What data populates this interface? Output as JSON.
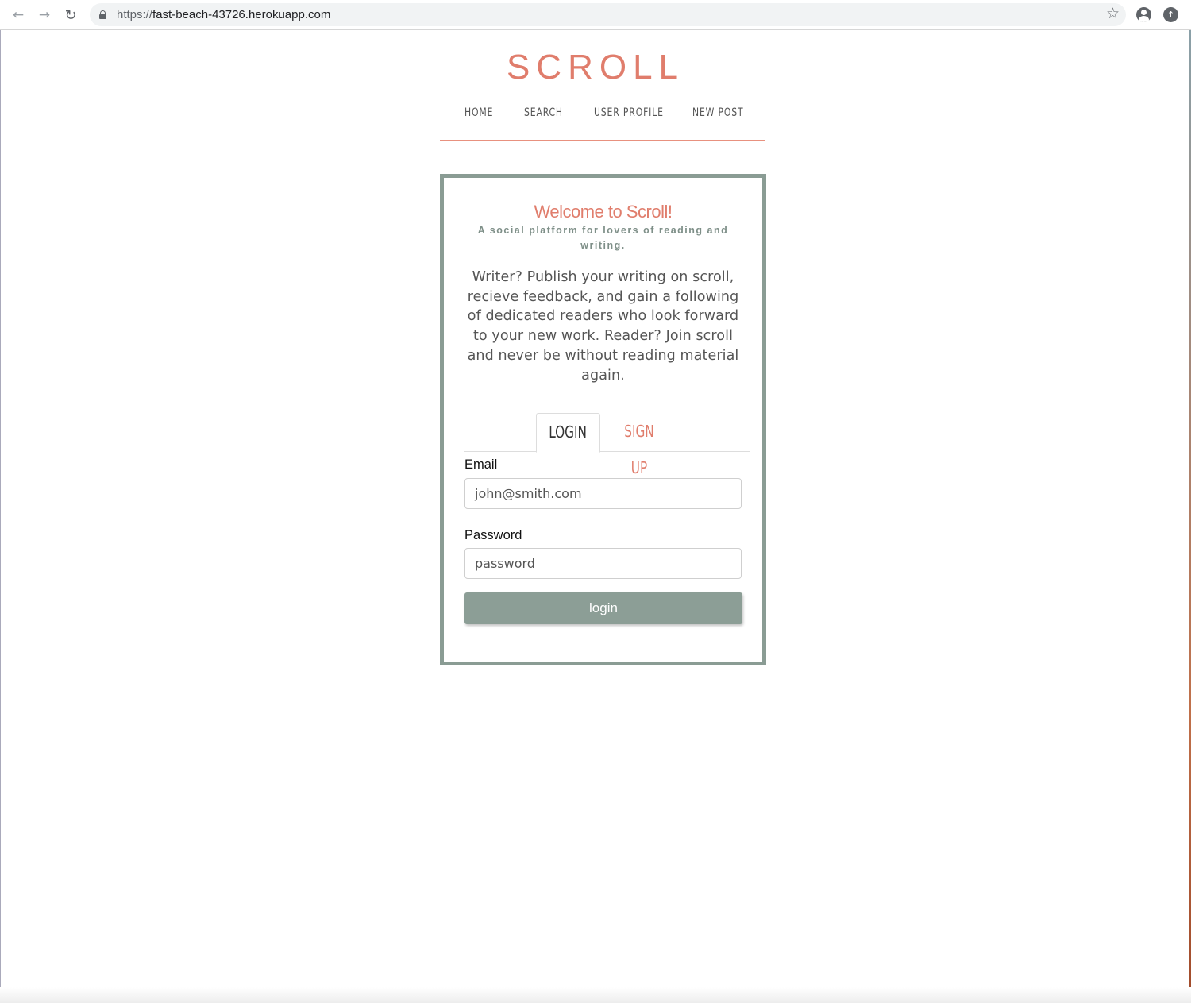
{
  "browser": {
    "url_scheme": "https://",
    "url_host": "fast-beach-43726.herokuapp.com",
    "back_icon": "←",
    "forward_icon": "→",
    "reload_icon": "↻",
    "bookmark_icon": "☆",
    "update_icon": "↑"
  },
  "site": {
    "brand": "SCROLL",
    "accent_color": "#e07d6c",
    "frame_color": "#8a9c94",
    "nav": [
      {
        "label": "HOME"
      },
      {
        "label": "SEARCH"
      },
      {
        "label": "USER PROFILE"
      },
      {
        "label": "NEW POST"
      }
    ]
  },
  "card": {
    "title": "Welcome to Scroll!",
    "tagline": "A social platform for lovers of reading and writing.",
    "intro": "Writer? Publish your writing on scroll, recieve feedback, and gain a following of dedicated readers who look forward to your new work. Reader? Join scroll and never be without reading material again.",
    "tabs": [
      {
        "label": "LOGIN",
        "active": true
      },
      {
        "label": "SIGN UP",
        "active": false
      }
    ],
    "email_label": "Email",
    "email_placeholder": "john@smith.com",
    "password_label": "Password",
    "password_placeholder": "password",
    "submit_label": "login"
  }
}
